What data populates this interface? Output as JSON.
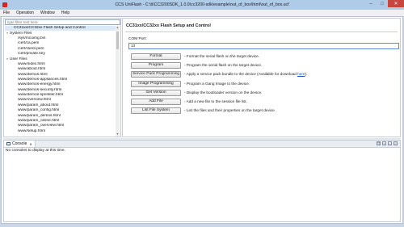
{
  "window": {
    "title": "CCS UniFlash - C:\\ti\\CC3200SDK_1.0.0\\cc3200-sdk\\example\\out_of_box\\html\\out_of_box.ucf",
    "minimize": "–",
    "maximize": "□",
    "close": "✕"
  },
  "menu": [
    "File",
    "Operation",
    "Window",
    "Help"
  ],
  "filter_placeholder": "type filter text here",
  "tree": [
    {
      "label": "CC31xx/CC32xx Flash Setup and Control",
      "indent": 1,
      "twisty": "",
      "selected": true
    },
    {
      "label": "System Files",
      "indent": 0,
      "twisty": "▿",
      "selected": false
    },
    {
      "label": "/sys/mcuimg.bin",
      "indent": 2,
      "twisty": "",
      "selected": false
    },
    {
      "label": "/cert/ca.pem",
      "indent": 2,
      "twisty": "",
      "selected": false
    },
    {
      "label": "/cert/client.pem",
      "indent": 2,
      "twisty": "",
      "selected": false
    },
    {
      "label": "/cert/private.key",
      "indent": 2,
      "twisty": "",
      "selected": false
    },
    {
      "label": "User Files",
      "indent": 0,
      "twisty": "▿",
      "selected": false
    },
    {
      "label": "www/index.html",
      "indent": 2,
      "twisty": "",
      "selected": false
    },
    {
      "label": "www/about.html",
      "indent": 2,
      "twisty": "",
      "selected": false
    },
    {
      "label": "www/demos.html",
      "indent": 2,
      "twisty": "",
      "selected": false
    },
    {
      "label": "www/demos-appliances.html",
      "indent": 2,
      "twisty": "",
      "selected": false
    },
    {
      "label": "www/demos-energy.html",
      "indent": 2,
      "twisty": "",
      "selected": false
    },
    {
      "label": "www/demos-security.html",
      "indent": 2,
      "twisty": "",
      "selected": false
    },
    {
      "label": "www/demos-sprinkler.html",
      "indent": 2,
      "twisty": "",
      "selected": false
    },
    {
      "label": "www/overview.html",
      "indent": 2,
      "twisty": "",
      "selected": false
    },
    {
      "label": "www/param_about.html",
      "indent": 2,
      "twisty": "",
      "selected": false
    },
    {
      "label": "www/param_config.html",
      "indent": 2,
      "twisty": "",
      "selected": false
    },
    {
      "label": "www/param_demos.html",
      "indent": 2,
      "twisty": "",
      "selected": false
    },
    {
      "label": "www/param_online.html",
      "indent": 2,
      "twisty": "",
      "selected": false
    },
    {
      "label": "www/param_overview.html",
      "indent": 2,
      "twisty": "",
      "selected": false
    },
    {
      "label": "www/setup.html",
      "indent": 2,
      "twisty": "",
      "selected": false
    }
  ],
  "panel": {
    "title": "CC31xx/CC32xx Flash Setup and Control",
    "com_label": "COM Port:",
    "com_value": "13",
    "actions": [
      {
        "label": "Format",
        "desc": "- Format the serial flash on the target device."
      },
      {
        "label": "Program",
        "desc": "- Program the serial flash on the target device."
      },
      {
        "label": "Service Pack Programming",
        "desc": "- Apply a service pack bundle to the device (Available for download ",
        "link": "here",
        "after": ")."
      },
      {
        "label": "Image Programming",
        "desc": "- Program a Gang Image to the device."
      },
      {
        "label": "Get Version",
        "desc": "- Display the bootloader version on the device."
      },
      {
        "label": "Add File",
        "desc": "- Add a new file to the session file list."
      },
      {
        "label": "List File System",
        "desc": "- List the files and their properties on the target device."
      }
    ]
  },
  "console": {
    "tab_label": "Console",
    "tab_close": "✕",
    "message": "No consoles to display at this time.",
    "tools": [
      "❐",
      "▿",
      "–",
      "□"
    ]
  },
  "colors": {
    "titlebar": "#aecbe8",
    "close": "#c7463d",
    "accent": "#5b8fce"
  }
}
